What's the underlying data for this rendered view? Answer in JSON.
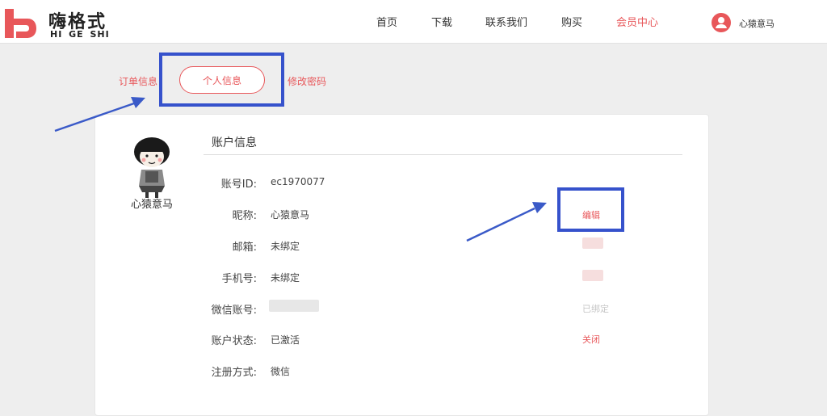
{
  "brand": {
    "name_cn": "嗨格式",
    "name_en": "HI GE SHI",
    "accent_color": "#e8575a"
  },
  "nav": {
    "items": [
      {
        "label": "首页",
        "active": false
      },
      {
        "label": "下载",
        "active": false
      },
      {
        "label": "联系我们",
        "active": false
      },
      {
        "label": "购买",
        "active": false
      },
      {
        "label": "会员中心",
        "active": true
      }
    ],
    "user_name": "心猿意马",
    "user_icon": "user-icon"
  },
  "tabs": {
    "orders": "订单信息",
    "profile": "个人信息",
    "password": "修改密码"
  },
  "profile": {
    "name": "心猿意马",
    "section_title": "账户信息",
    "rows": [
      {
        "label": "账号ID:",
        "value": "ec1970077",
        "action": ""
      },
      {
        "label": "昵称:",
        "value": "心猿意马",
        "action": "编辑"
      },
      {
        "label": "邮箱:",
        "value": "未绑定",
        "action": ""
      },
      {
        "label": "手机号:",
        "value": "未绑定",
        "action": ""
      },
      {
        "label": "微信账号:",
        "value": "",
        "action": "已绑定"
      },
      {
        "label": "账户状态:",
        "value": "已激活",
        "action": "关闭"
      },
      {
        "label": "注册方式:",
        "value": "微信",
        "action": ""
      }
    ]
  },
  "annotation": {
    "box_color": "#3652cc",
    "arrow_color": "#3a5ac8"
  }
}
